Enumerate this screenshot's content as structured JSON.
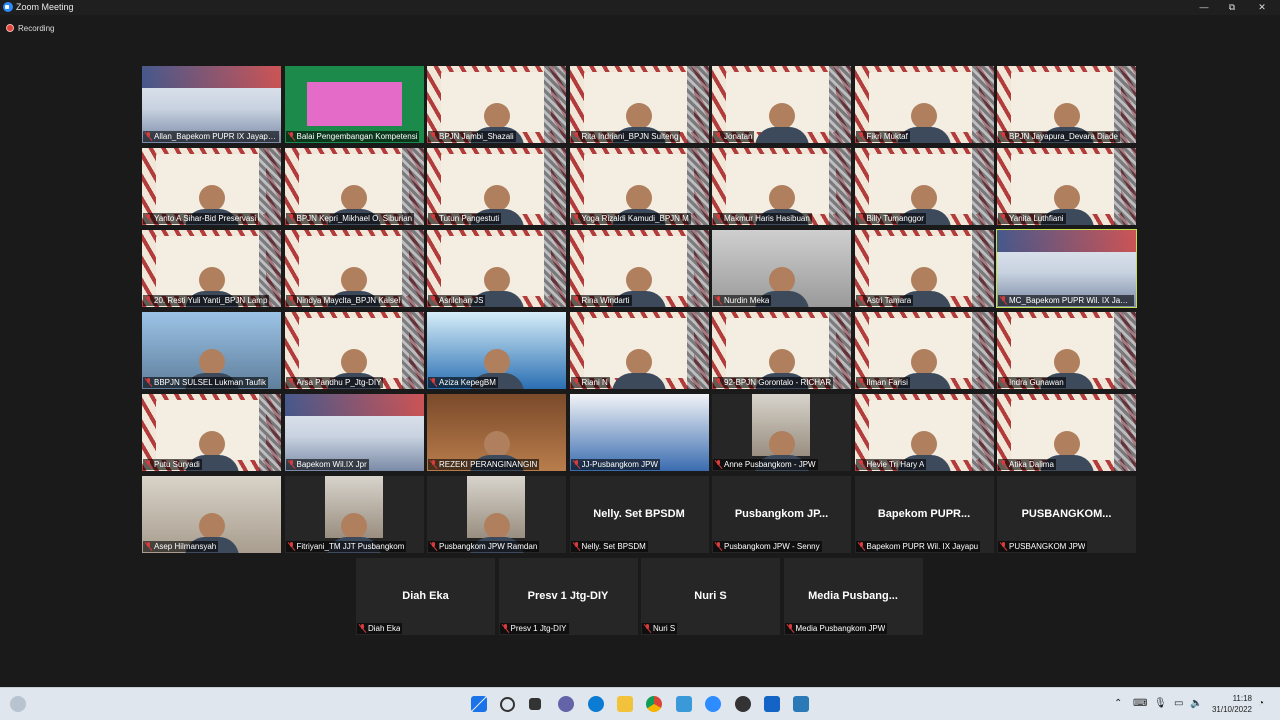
{
  "window": {
    "title": "Zoom Meeting",
    "minimize": "—",
    "restore": "⧉",
    "close": "✕"
  },
  "status": {
    "recording_label": "Recording"
  },
  "participants": [
    {
      "label": "Allan_Bapekom PUPR IX Jayapura",
      "bg": "wil"
    },
    {
      "label": "Balai Pengembangan Kompetensi",
      "bg": "green"
    },
    {
      "label": "BPJN Jambi_Shazali",
      "bg": "banner"
    },
    {
      "label": "Rita Indriani_BPJN Sulteng",
      "bg": "banner"
    },
    {
      "label": "Jonatan",
      "bg": "banner"
    },
    {
      "label": "Fikri Muktaf",
      "bg": "banner"
    },
    {
      "label": "BPJN Jayapura_Devara Diade",
      "bg": "banner"
    },
    {
      "label": "Yanto A Sihar-Bid Preservasi",
      "bg": "banner"
    },
    {
      "label": "BPJN Kepri_Mikhael O. Siburian",
      "bg": "banner"
    },
    {
      "label": "Tutun Pangestuti",
      "bg": "banner"
    },
    {
      "label": "Yoga Rizaldi Kamudi_BPJN M",
      "bg": "banner"
    },
    {
      "label": "Makmur Haris Hasibuan",
      "bg": "banner"
    },
    {
      "label": "Billy Tumanggor",
      "bg": "banner"
    },
    {
      "label": "Yanita Luthfiani",
      "bg": "banner"
    },
    {
      "label": "20. Resti Yuli Yanti_BPJN Lamp",
      "bg": "banner"
    },
    {
      "label": "Nindya Mayclta_BPJN Kalsel",
      "bg": "banner"
    },
    {
      "label": "Asrilchan JS",
      "bg": "banner"
    },
    {
      "label": "Rina Windarti",
      "bg": "banner"
    },
    {
      "label": "Nurdin Meka",
      "bg": "grey"
    },
    {
      "label": "Astri Tamara",
      "bg": "banner"
    },
    {
      "label": "MC_Bapekom PUPR Wil. IX Jayap",
      "bg": "wil",
      "active": true
    },
    {
      "label": "BBPJN SULSEL Lukman Taufik",
      "bg": "city"
    },
    {
      "label": "Arsa Pandhu P_Jtg-DIY",
      "bg": "banner"
    },
    {
      "label": "Aziza KepegBM",
      "bg": "blue"
    },
    {
      "label": "Riani N",
      "bg": "banner"
    },
    {
      "label": "92-BPJN Gorontalo - RICHAR",
      "bg": "banner"
    },
    {
      "label": "Ilman Farisi",
      "bg": "banner"
    },
    {
      "label": "Indra Gunawan",
      "bg": "banner"
    },
    {
      "label": "Putu Suryadi",
      "bg": "banner"
    },
    {
      "label": "Bapekom Wil.IX Jpr",
      "bg": "wil"
    },
    {
      "label": "REZEKI PERANGINANGIN",
      "bg": "wood"
    },
    {
      "label": "JJ-Pusbangkom JPW",
      "bg": "doc"
    },
    {
      "label": "Anne Pusbangkom - JPW",
      "bg": "pic"
    },
    {
      "label": "Hevie Tri Hary A",
      "bg": "banner"
    },
    {
      "label": "Atika Dalima",
      "bg": "banner"
    },
    {
      "label": "Asep Hilmansyah",
      "bg": "room"
    },
    {
      "label": "Fitriyani_TM JJT Pusbangkom",
      "bg": "pic"
    },
    {
      "label": "Pusbangkom JPW Ramdan",
      "bg": "pic"
    },
    {
      "label": "Nelly. Set BPSDM",
      "bg": "dark",
      "big": "Nelly. Set BPSDM"
    },
    {
      "label": "Pusbangkom JPW - Senny",
      "bg": "dark",
      "big": "Pusbangkom  JP..."
    },
    {
      "label": "Bapekom PUPR Wil. IX Jayapu",
      "bg": "dark",
      "big": "Bapekom  PUPR..."
    },
    {
      "label": "PUSBANGKOM JPW",
      "bg": "dark",
      "big": "PUSBANGKOM..."
    },
    {
      "label": "Diah Eka",
      "bg": "dark",
      "big": "Diah Eka"
    },
    {
      "label": "Presv 1 Jtg-DIY",
      "bg": "dark",
      "big": "Presv 1 Jtg-DIY"
    },
    {
      "label": "Nuri S",
      "bg": "dark",
      "big": "Nuri S"
    },
    {
      "label": "Media Pusbangkom JPW",
      "bg": "dark",
      "big": "Media  Pusbang..."
    }
  ],
  "taskbar": {
    "time": "11:18",
    "date": "31/10/2022",
    "icons": [
      "windows-start",
      "search",
      "task-view",
      "chat",
      "edge",
      "file-explorer",
      "chrome",
      "notepad",
      "zoom",
      "recorder",
      "media-player",
      "photos"
    ]
  },
  "colors": {
    "active_outline": "#c7e04a",
    "mute": "#d93a3a",
    "taskbar": "#dfe6ee"
  }
}
